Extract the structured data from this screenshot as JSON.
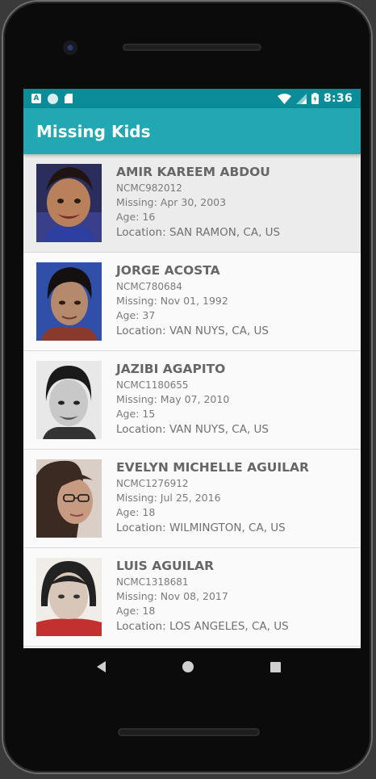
{
  "status_bar": {
    "time": "8:36",
    "icons": [
      "a-notification-icon",
      "circle-notification-icon",
      "sd-card-icon",
      "wifi-icon",
      "signal-icon",
      "battery-icon"
    ]
  },
  "app_bar": {
    "title": "Missing Kids",
    "color": "#21a8b2"
  },
  "kids": [
    {
      "name": "AMIR KAREEM ABDOU",
      "case": "NCMC982012",
      "missing": "Missing: Apr 30, 2003",
      "age": "Age: 16",
      "location": "Location: SAN RAMON, CA, US"
    },
    {
      "name": "JORGE ACOSTA",
      "case": "NCMC780684",
      "missing": "Missing: Nov 01, 1992",
      "age": "Age: 37",
      "location": "Location: VAN NUYS, CA, US"
    },
    {
      "name": "JAZIBI AGAPITO",
      "case": "NCMC1180655",
      "missing": "Missing: May 07, 2010",
      "age": "Age: 15",
      "location": "Location: VAN NUYS, CA, US"
    },
    {
      "name": "EVELYN MICHELLE AGUILAR",
      "case": "NCMC1276912",
      "missing": "Missing: Jul 25, 2016",
      "age": "Age: 18",
      "location": "Location: WILMINGTON, CA, US"
    },
    {
      "name": "LUIS AGUILAR",
      "case": "NCMC1318681",
      "missing": "Missing: Nov 08, 2017",
      "age": "Age: 18",
      "location": "Location: LOS ANGELES, CA, US"
    }
  ],
  "nav": {
    "icons": [
      "back-icon",
      "home-icon",
      "recents-icon"
    ]
  }
}
